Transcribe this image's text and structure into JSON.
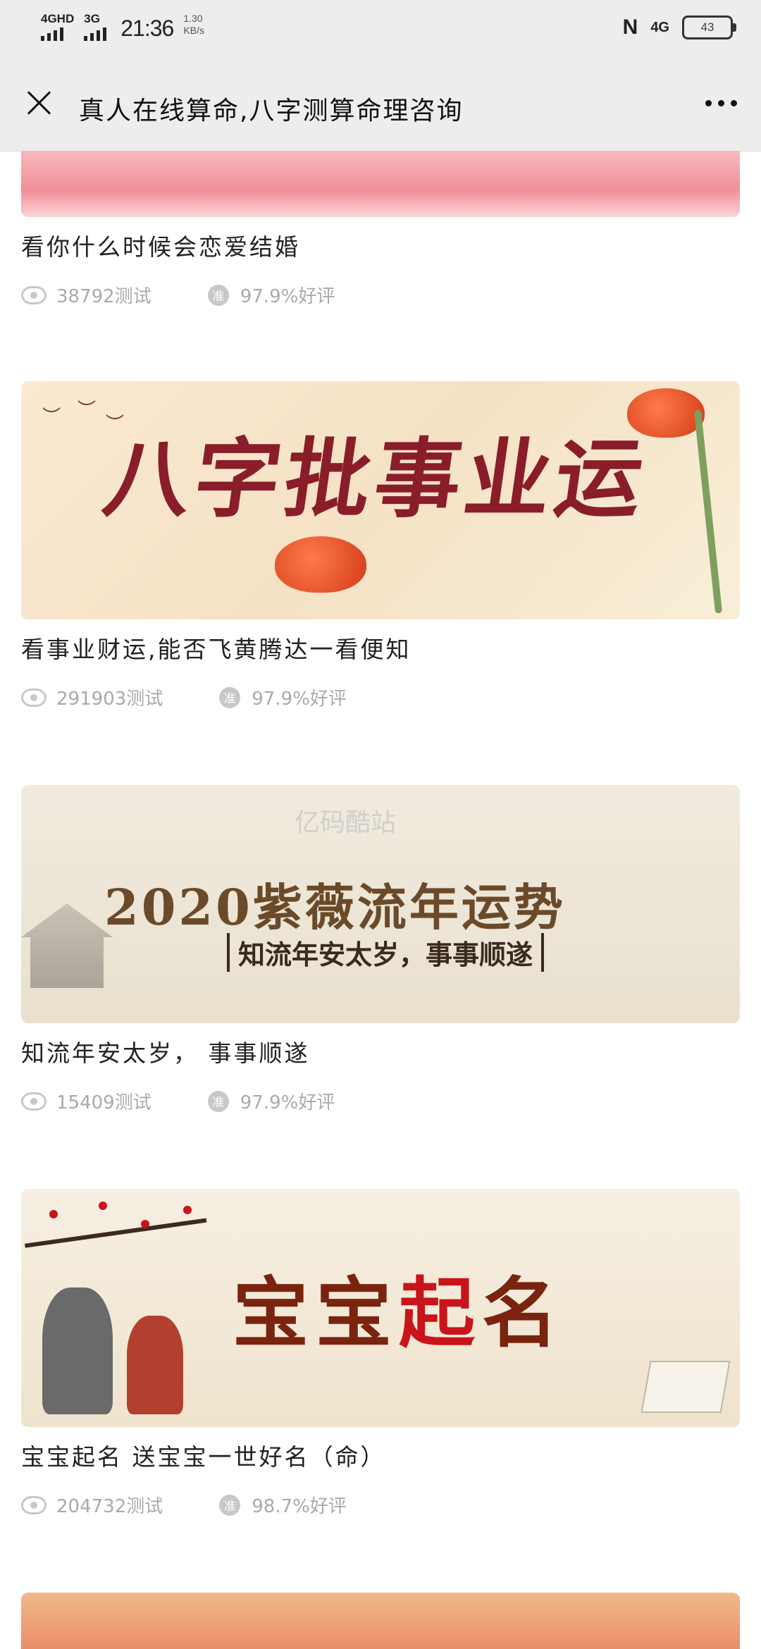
{
  "status_bar": {
    "network1": "4GHD",
    "network2": "3G",
    "time": "21:36",
    "speed_value": "1.30",
    "speed_unit": "KB/s",
    "right_network": "4G",
    "battery": "43"
  },
  "header": {
    "title": "真人在线算命,八字测算命理咨询"
  },
  "cards": [
    {
      "title": "看你什么时候会恋爱结婚",
      "views": "38792测试",
      "rating_badge": "准",
      "rating": "97.9%好评"
    },
    {
      "banner_text": "八字批事业运",
      "title": "看事业财运,能否飞黄腾达一看便知",
      "views": "291903测试",
      "rating_badge": "准",
      "rating": "97.9%好评"
    },
    {
      "banner_logo": "亿码酷站",
      "banner_title": "2020紫薇流年运势",
      "banner_sub": "知流年安太岁，事事顺遂",
      "title": "知流年安太岁， 事事顺遂",
      "views": "15409测试",
      "rating_badge": "准",
      "rating": "97.9%好评"
    },
    {
      "banner_title": "宝宝起名",
      "title": "宝宝起名 送宝宝一世好名（命）",
      "views": "204732测试",
      "rating_badge": "准",
      "rating": "98.7%好评"
    }
  ],
  "colors": {
    "header_bg": "#ededed",
    "muted_text": "#aaaaaa",
    "title_text": "#222222"
  }
}
